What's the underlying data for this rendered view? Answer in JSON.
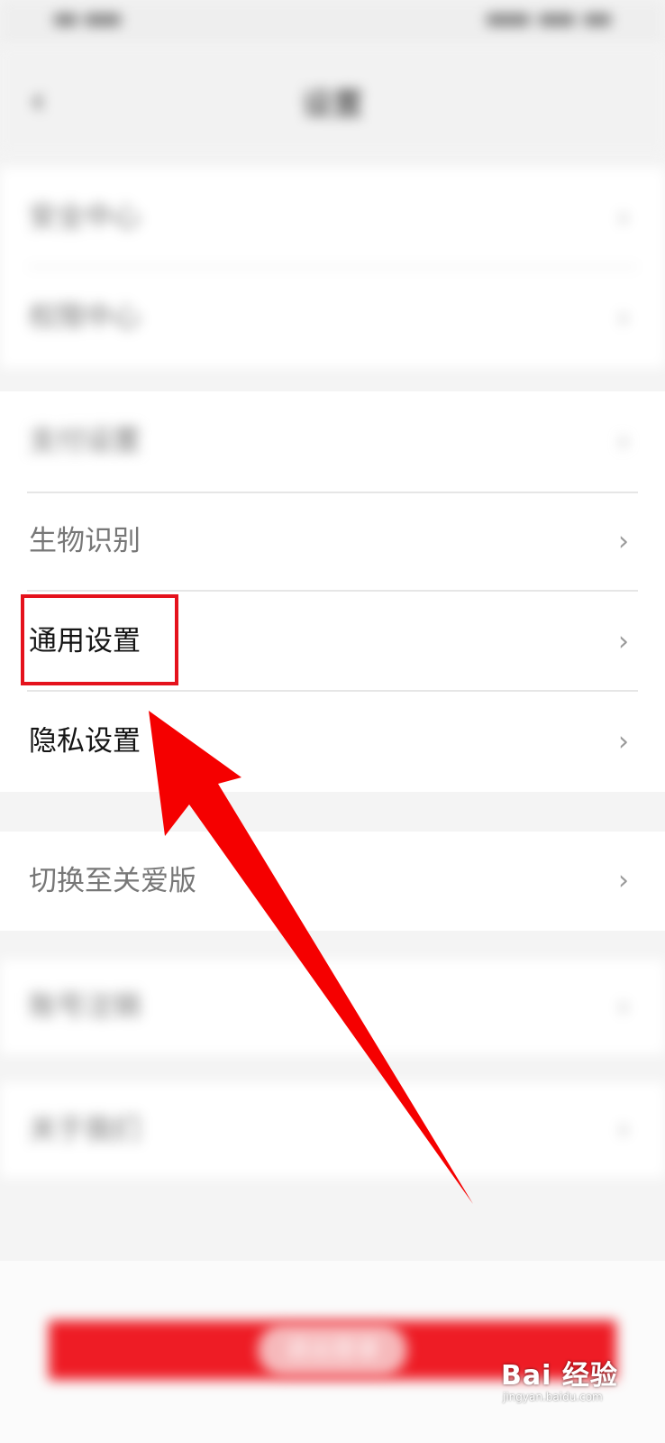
{
  "nav": {
    "back_icon": "back-arrow-icon",
    "title": "设置"
  },
  "groups": [
    {
      "items": [
        {
          "label": "安全中心"
        },
        {
          "label": "权限中心"
        }
      ]
    },
    {
      "items": [
        {
          "label": "支付设置"
        },
        {
          "label": "生物识别"
        },
        {
          "label": "通用设置"
        },
        {
          "label": "隐私设置"
        }
      ]
    },
    {
      "items": [
        {
          "label": "切换至关爱版"
        }
      ]
    },
    {
      "items": [
        {
          "label": "账号注销"
        }
      ]
    },
    {
      "items": [
        {
          "label": "关于我们"
        }
      ]
    }
  ],
  "chevron": "›",
  "logout": {
    "label": "退出登录"
  },
  "watermark": {
    "text": "Bai 经验",
    "sub": "jingyan.baidu.com"
  },
  "colors": {
    "accent": "#ee1c25",
    "annotation": "#e5121c",
    "arrow": "#f50000"
  }
}
